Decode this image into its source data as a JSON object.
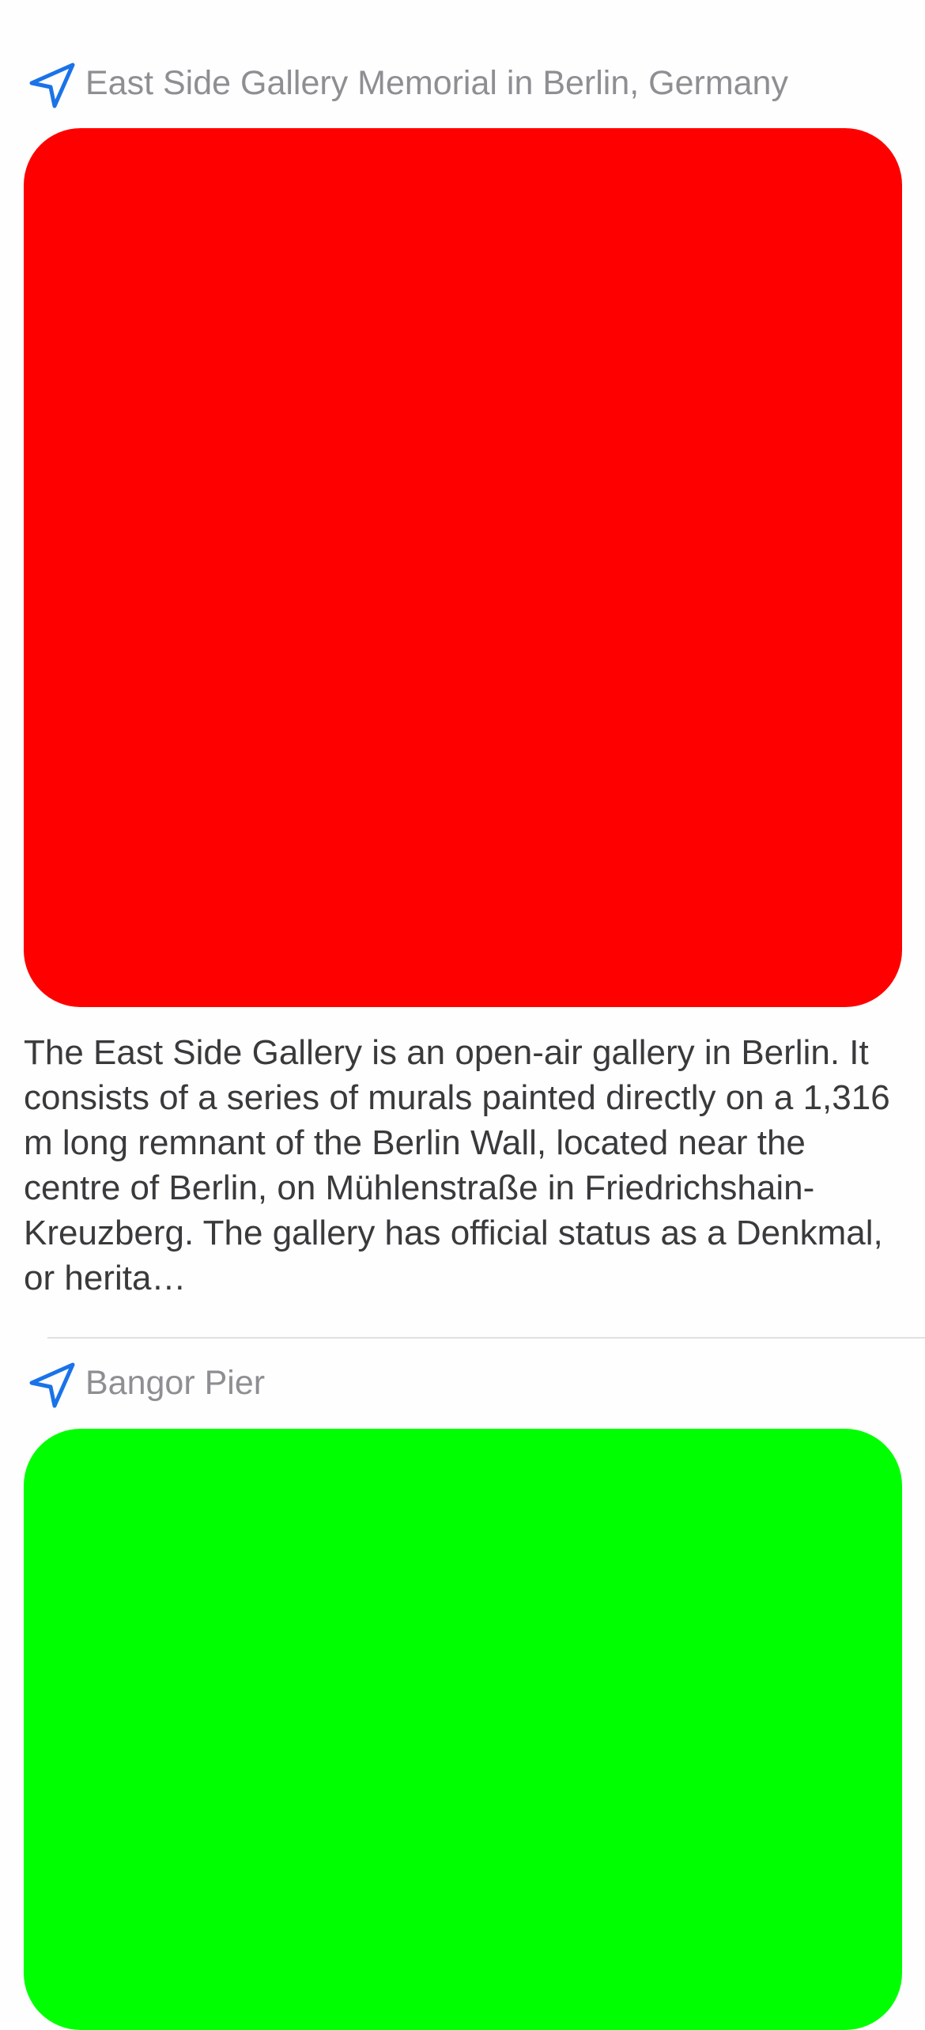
{
  "feed": {
    "items": [
      {
        "location_icon": "location-arrow-icon",
        "location": "East Side Gallery Memorial in Berlin, Germany",
        "image_color": "#ff0000",
        "description": "The East Side Gallery is an open-air gallery in Berlin. It consists of a series of murals painted directly on a 1,316 m long remnant of the Berlin Wall, located near the centre of Berlin, on Mühlenstraße in Friedrichshain-Kreuzberg. The gallery has official status as a Denkmal, or herita…"
      },
      {
        "location_icon": "location-arrow-icon",
        "location": "Bangor Pier",
        "image_color": "#00ff00"
      }
    ]
  },
  "colors": {
    "accent": "#1a73e8",
    "secondary_text": "#8e8e93",
    "body_text": "#3a3a3c",
    "divider": "#e1e1e3"
  }
}
